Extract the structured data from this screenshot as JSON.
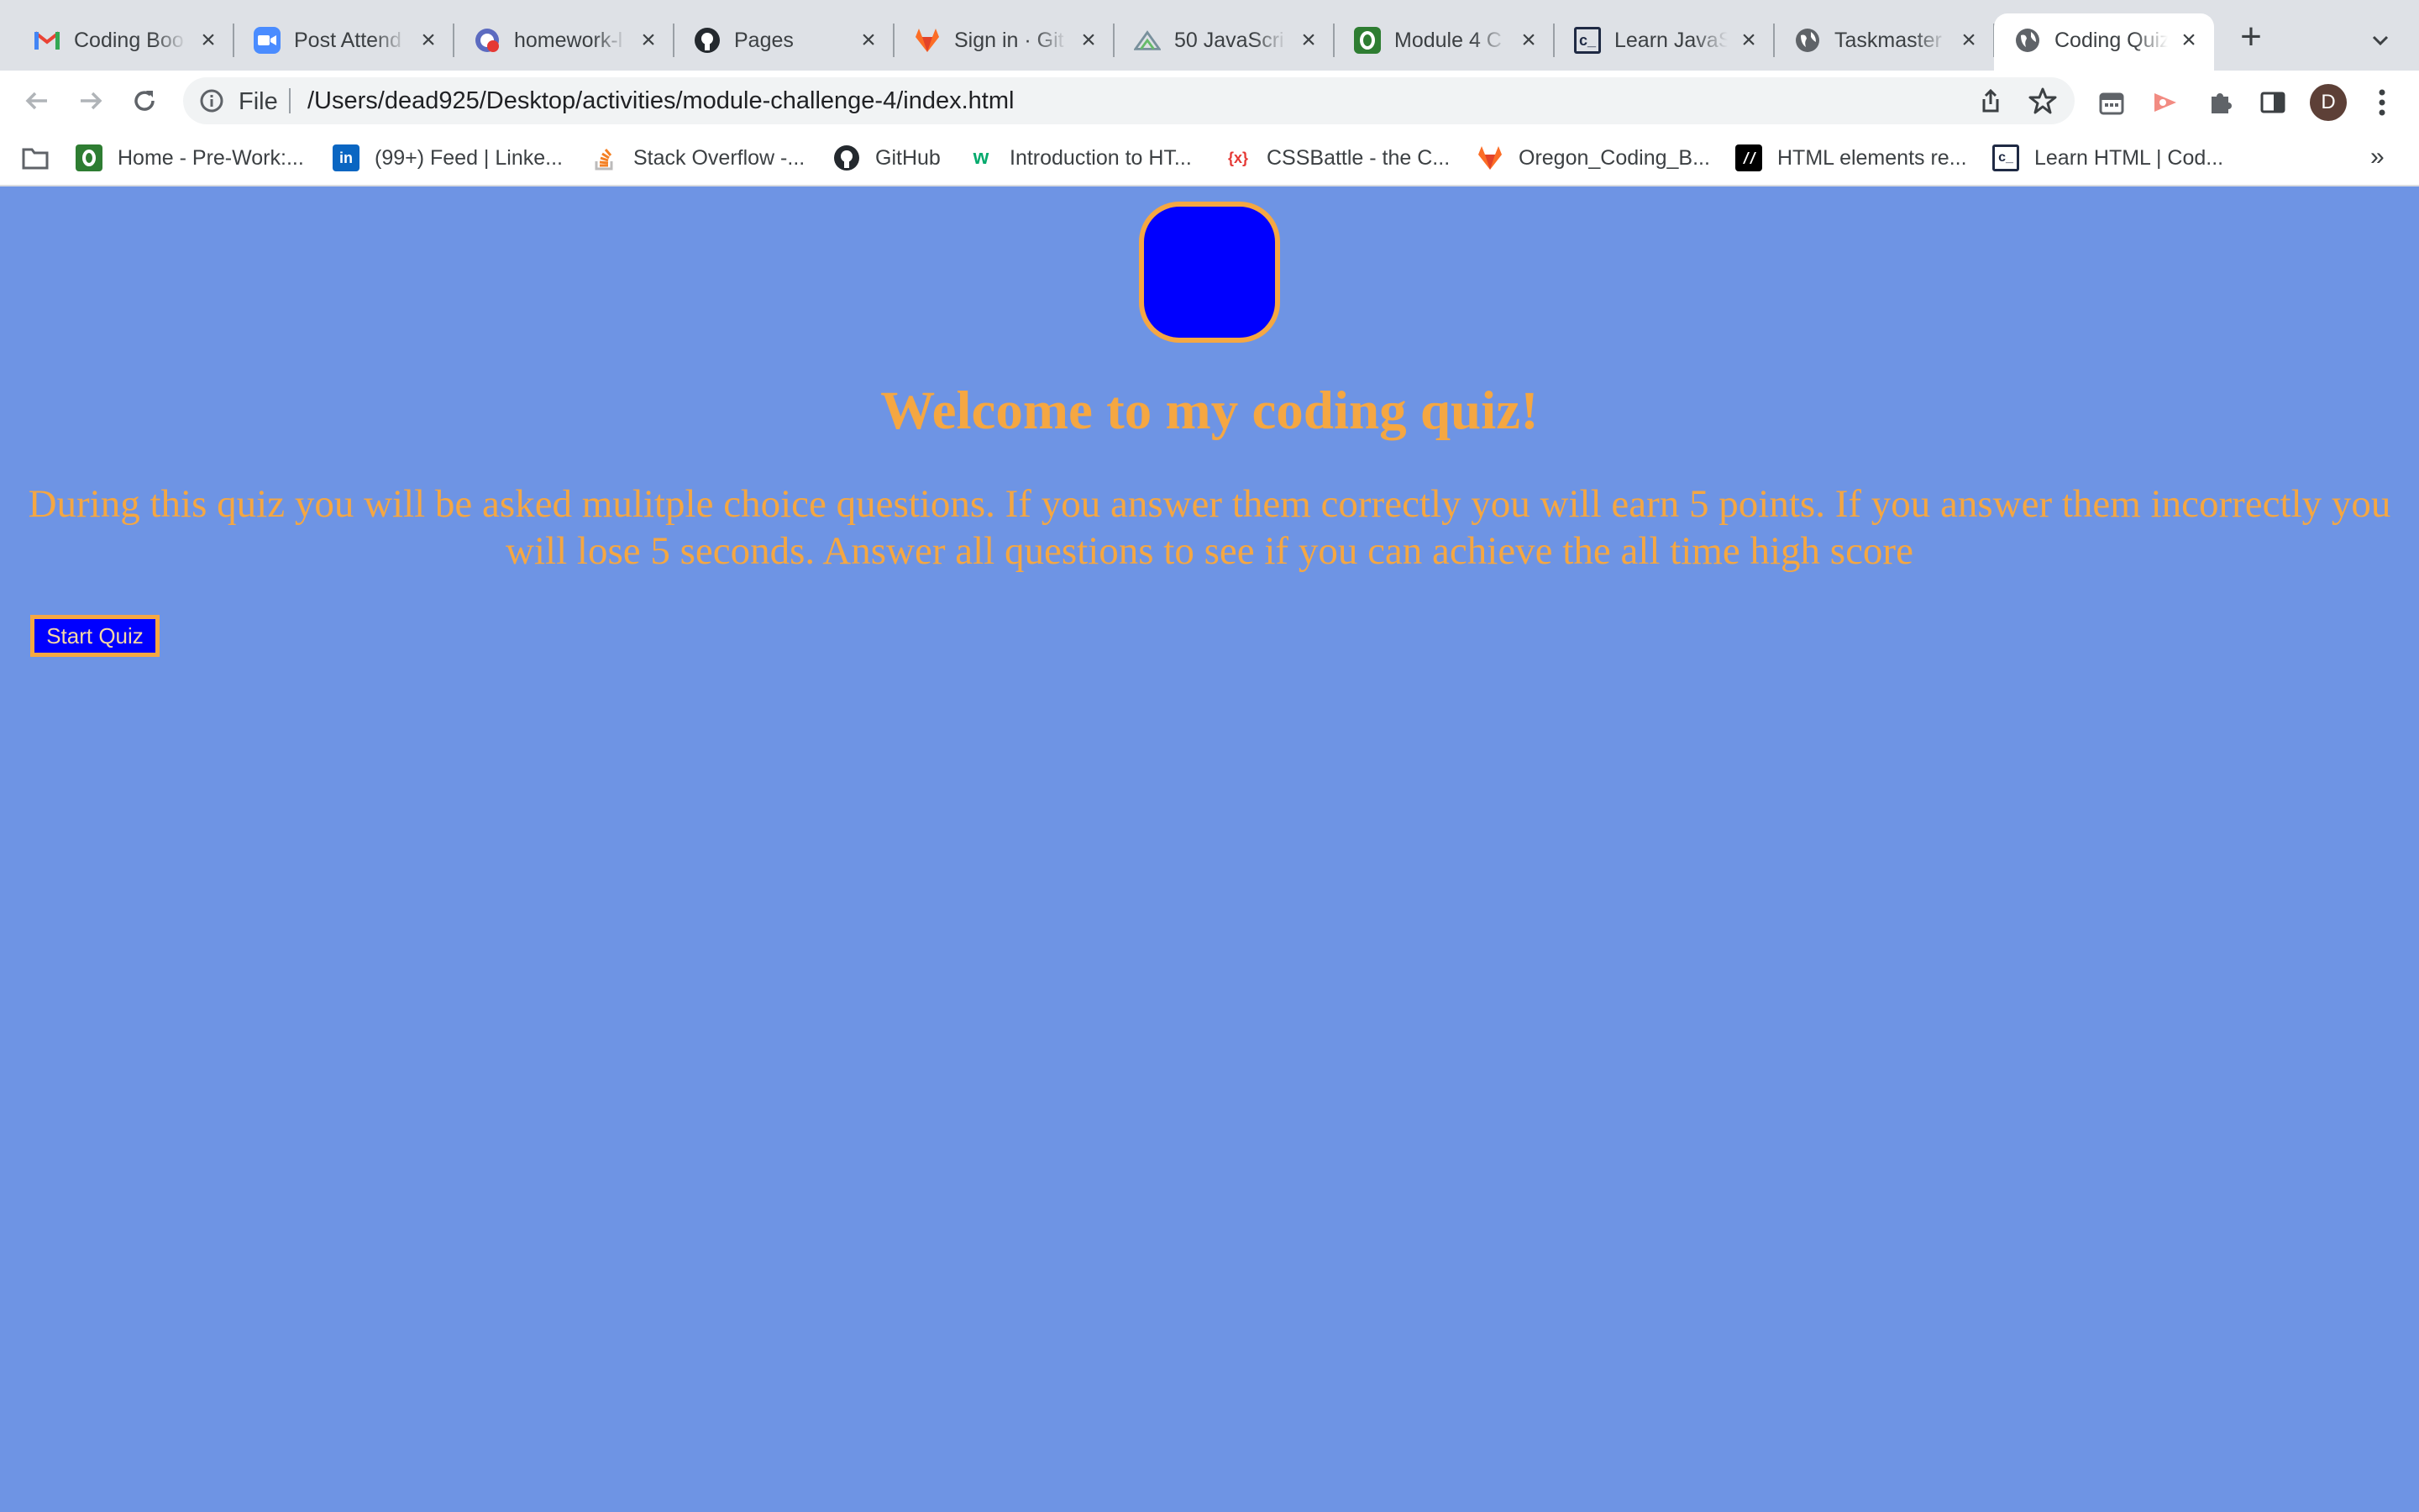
{
  "browser": {
    "tabs": [
      {
        "title": "Coding Boo",
        "icon": "gmail-icon"
      },
      {
        "title": "Post Attend",
        "icon": "zoom-icon"
      },
      {
        "title": "homework-l",
        "icon": "google-tasks-icon"
      },
      {
        "title": "Pages",
        "icon": "github-icon"
      },
      {
        "title": "Sign in · Git",
        "icon": "gitlab-icon"
      },
      {
        "title": "50 JavaScri",
        "icon": "javascript-icon"
      },
      {
        "title": "Module 4 C",
        "icon": "course-icon"
      },
      {
        "title": "Learn JavaS",
        "icon": "codecademy-icon"
      },
      {
        "title": "Taskmaster",
        "icon": "globe-icon"
      },
      {
        "title": "Coding Quiz",
        "icon": "globe-icon",
        "active": true
      }
    ],
    "address": {
      "scheme_label": "File",
      "url": "/Users/dead925/Desktop/activities/module-challenge-4/index.html"
    },
    "profile_initial": "D",
    "bookmarks": [
      {
        "label": "",
        "icon": "folder-icon"
      },
      {
        "label": "Home - Pre-Work:...",
        "icon": "course-icon"
      },
      {
        "label": "(99+) Feed | Linke...",
        "icon": "linkedin-icon"
      },
      {
        "label": "Stack Overflow -...",
        "icon": "stackoverflow-icon"
      },
      {
        "label": "GitHub",
        "icon": "github-icon"
      },
      {
        "label": "Introduction to HT...",
        "icon": "w3-icon"
      },
      {
        "label": "CSSBattle - the C...",
        "icon": "cssbattle-icon"
      },
      {
        "label": "Oregon_Coding_B...",
        "icon": "gitlab-icon"
      },
      {
        "label": "HTML elements re...",
        "icon": "mdn-icon"
      },
      {
        "label": "Learn HTML | Cod...",
        "icon": "codecademy-icon"
      }
    ]
  },
  "page": {
    "heading": "Welcome to my coding quiz!",
    "description": "During this quiz you will be asked mulitple choice questions. If you answer them correctly you will earn 5 points. If you answer them incorrectly you will lose 5 seconds. Answer all questions to see if you can achieve the all time high score",
    "start_button": "Start Quiz"
  },
  "colors": {
    "page_background": "#6e94e4",
    "accent_orange": "#f5a742",
    "logo_blue": "#0000ff"
  }
}
